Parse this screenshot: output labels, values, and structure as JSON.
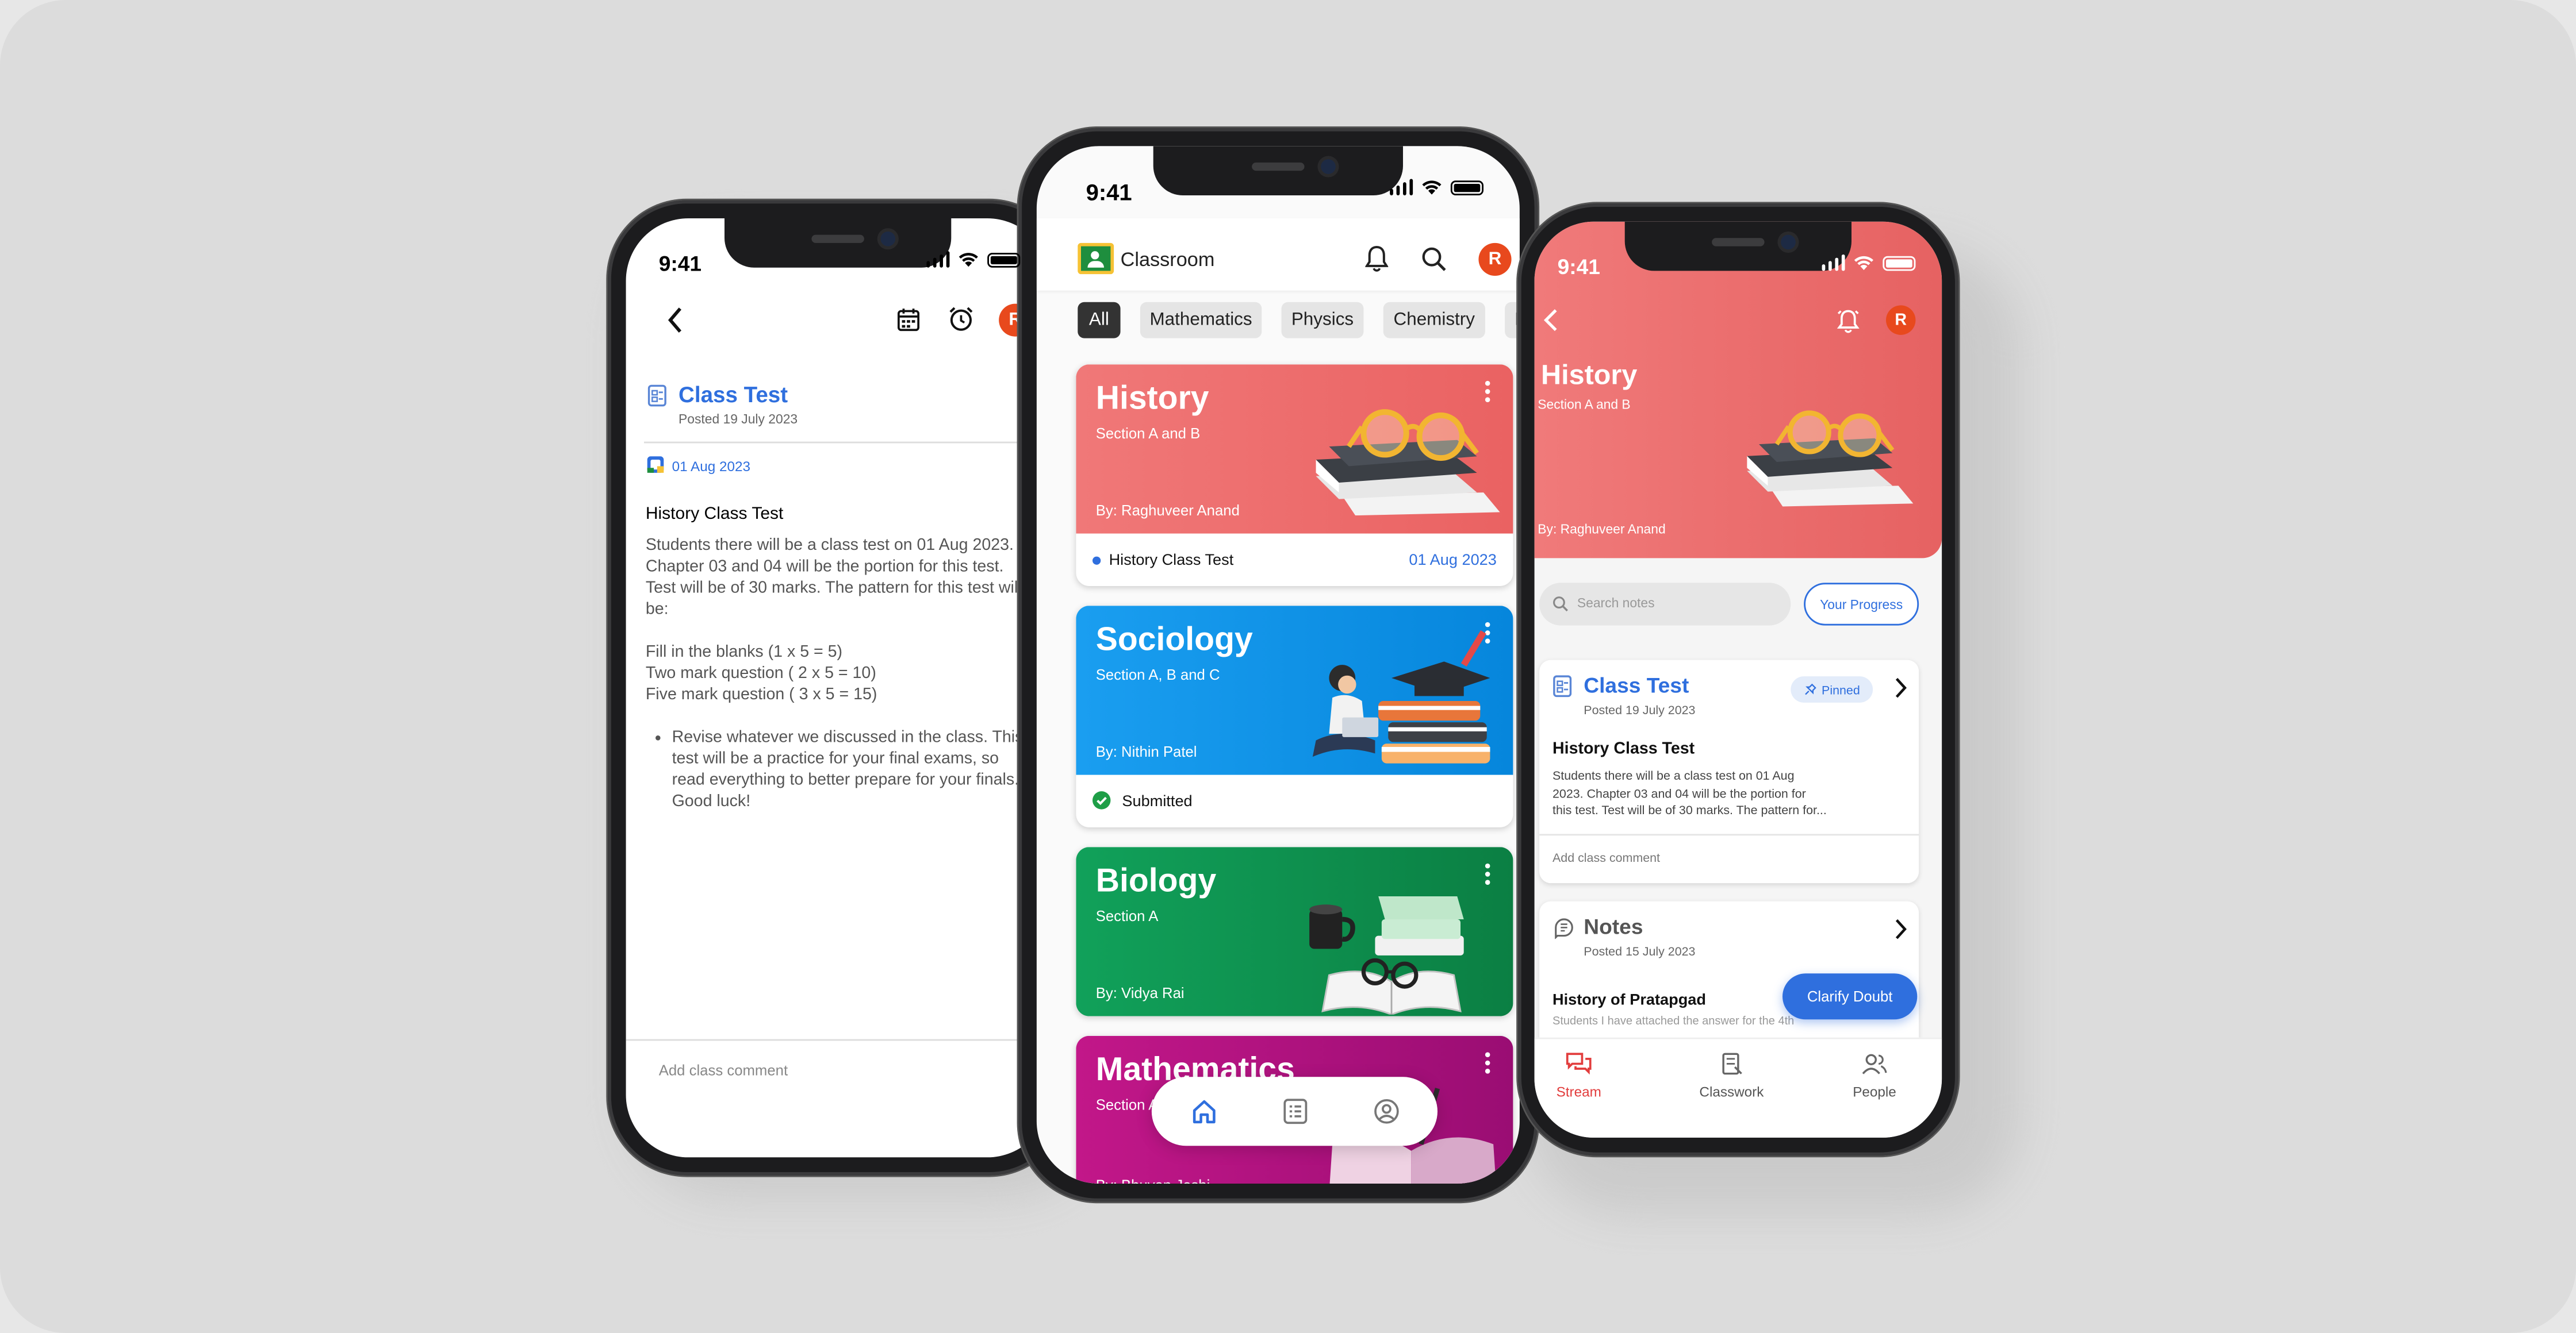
{
  "status_time": "9:41",
  "colors": {
    "accent_blue": "#2f6fde",
    "avatar_orange": "#e8491d",
    "history_red": "#ef6c6c",
    "sociology_blue": "#0b95e8",
    "biology_green": "#0e9150",
    "math_magenta": "#b0107e",
    "brand_yellow": "#f6c234",
    "brand_green": "#1e8e3e"
  },
  "left_phone": {
    "header_icons": [
      "back-arrow-icon",
      "calendar-icon",
      "alarm-clock-icon"
    ],
    "avatar_initial": "R",
    "post_title": "Class Test",
    "post_date": "Posted 19 July 2023",
    "due_date": "01 Aug 2023",
    "heading": "History Class Test",
    "body_lines": [
      "Students there will be a class test on 01 Aug 2023.",
      "Chapter 03 and 04 will be the portion for this test.",
      "Test will be of 30 marks. The pattern for this test will",
      "be:"
    ],
    "pattern_lines": [
      "Fill in the blanks (1 x 5 = 5)",
      "Two mark question ( 2 x 5 = 10)",
      "Five mark question ( 3 x 5 = 15)"
    ],
    "bullet_lines": [
      "Revise whatever we discussed in the class. This",
      "test will be a practice for your final exams, so",
      "read everything to better prepare for your finals.",
      "Good luck!"
    ],
    "comment_placeholder": "Add class comment"
  },
  "center_phone": {
    "app_name": "Classroom",
    "avatar_initial": "R",
    "filters": [
      "All",
      "Mathematics",
      "Physics",
      "Chemistry",
      "Bi"
    ],
    "active_filter": "All",
    "cards": [
      {
        "title": "History",
        "section": "Section A and B",
        "teacher": "By: Raghuveer Anand",
        "footer_text": "History Class Test",
        "footer_date": "01 Aug 2023"
      },
      {
        "title": "Sociology",
        "section": "Section A, B and C",
        "teacher": "By: Nithin Patel",
        "footer_text": "Submitted"
      },
      {
        "title": "Biology",
        "section": "Section A",
        "teacher": "By: Vidya Rai"
      },
      {
        "title": "Mathematics",
        "section": "Section A",
        "teacher": "By: Bhuvan Joshi"
      }
    ],
    "nav_icons": [
      "home-icon",
      "list-icon",
      "profile-icon"
    ]
  },
  "right_phone": {
    "class_title": "History",
    "section": "Section A and B",
    "teacher": "By: Raghuveer Anand",
    "avatar_initial": "R",
    "search_placeholder": "Search notes",
    "progress_button": "Your Progress",
    "post1": {
      "title": "Class Test",
      "date": "Posted 19 July 2023",
      "badge": "Pinned",
      "heading": "History Class Test",
      "lines": [
        "Students there will be a class test on 01 Aug",
        "2023. Chapter 03 and 04 will be the portion for",
        "this test. Test will be of 30 marks. The pattern for..."
      ],
      "comment": "Add class comment"
    },
    "post2": {
      "title": "Notes",
      "date": "Posted 15 July 2023",
      "heading": "History of Pratapgad",
      "snippet": "Students I have attached the answer for the 4th"
    },
    "fab_label": "Clarify Doubt",
    "tabs": [
      "Stream",
      "Classwork",
      "People"
    ],
    "active_tab": "Stream"
  }
}
